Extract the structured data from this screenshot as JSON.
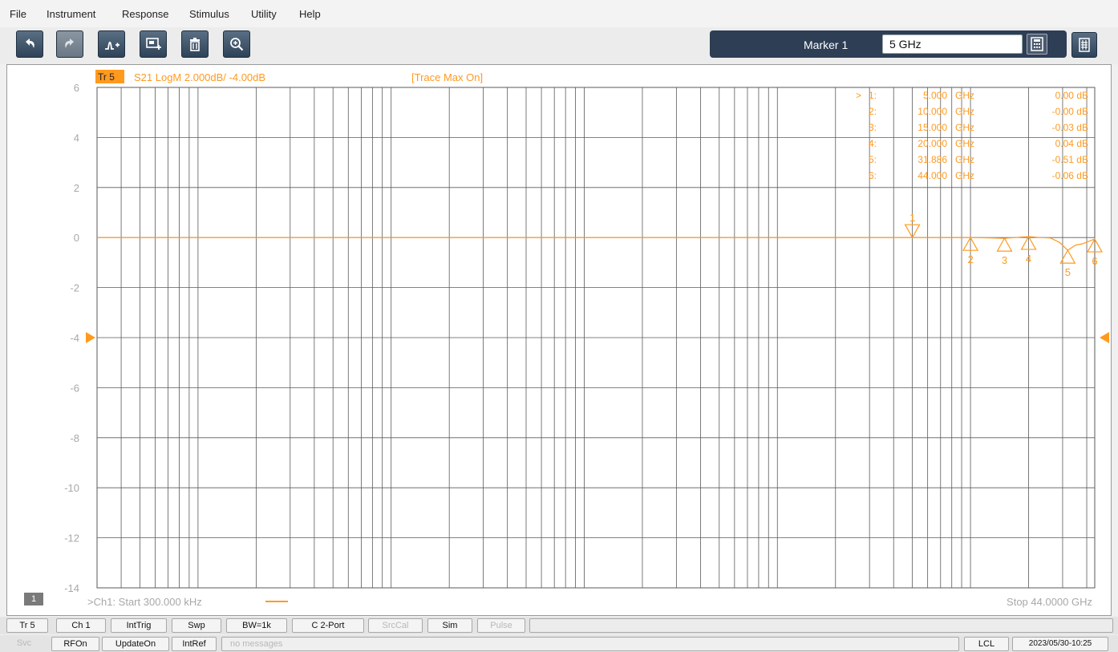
{
  "menu": [
    "File",
    "Instrument",
    "Response",
    "Stimulus",
    "Utility",
    "Help"
  ],
  "toolbar": {
    "icons": [
      "undo-icon",
      "redo-icon",
      "add-trace-icon",
      "add-window-icon",
      "delete-icon",
      "zoom-icon"
    ],
    "marker_label": "Marker 1",
    "marker_value": "5 GHz"
  },
  "trace": {
    "badge": "Tr 5",
    "title": "S21 LogM 2.000dB/ -4.00dB",
    "status": "[Trace Max On]",
    "color": "#ff9a1f"
  },
  "markers": [
    {
      "id": "1",
      "prefix": ">",
      "freq": "5.000",
      "unit": "GHz",
      "value": "0.00 dB"
    },
    {
      "id": "2",
      "prefix": "",
      "freq": "10.000",
      "unit": "GHz",
      "value": "-0.00 dB"
    },
    {
      "id": "3",
      "prefix": "",
      "freq": "15.000",
      "unit": "GHz",
      "value": "-0.03 dB"
    },
    {
      "id": "4",
      "prefix": "",
      "freq": "20.000",
      "unit": "GHz",
      "value": "0.04 dB"
    },
    {
      "id": "5",
      "prefix": "",
      "freq": "31.886",
      "unit": "GHz",
      "value": "-0.51 dB"
    },
    {
      "id": "6",
      "prefix": "",
      "freq": "44.000",
      "unit": "GHz",
      "value": "-0.06 dB"
    }
  ],
  "chart_data": {
    "type": "line",
    "title": "S21 LogM 2.000dB/ -4.00dB",
    "ylim": [
      -14,
      6
    ],
    "yticks": [
      6,
      4,
      2,
      0,
      -2,
      -4,
      -6,
      -8,
      -10,
      -12,
      -14
    ],
    "reference_level": -4,
    "x_start": "300.000 kHz",
    "x_stop": "44.0000 GHz",
    "log_x": true,
    "grid": true,
    "series": [
      {
        "name": "Tr 5",
        "x_ghz": [
          0.0003,
          10,
          12,
          15,
          17,
          20,
          23,
          26,
          29,
          31.886,
          35,
          38,
          41,
          44
        ],
        "y": [
          0.0,
          -0.0,
          -0.01,
          -0.03,
          0.0,
          0.04,
          0.0,
          -0.02,
          -0.2,
          -0.51,
          -0.3,
          -0.25,
          -0.15,
          -0.06
        ]
      }
    ],
    "marker_points": [
      {
        "label": "1",
        "x_ghz": 5.0,
        "y": 0.0
      },
      {
        "label": "2",
        "x_ghz": 10.0,
        "y": -0.0
      },
      {
        "label": "3",
        "x_ghz": 15.0,
        "y": -0.03
      },
      {
        "label": "4",
        "x_ghz": 20.0,
        "y": 0.04
      },
      {
        "label": "5",
        "x_ghz": 31.886,
        "y": -0.51
      },
      {
        "label": "6",
        "x_ghz": 44.0,
        "y": -0.06
      }
    ],
    "channel": "1",
    "start_label": ">Ch1:  Start  300.000 kHz",
    "stop_label": "Stop  44.0000 GHz"
  },
  "status_row1": [
    "Tr 5",
    "Ch 1",
    "IntTrig",
    "Swp",
    "BW=1k",
    "C  2-Port",
    "SrcCal",
    "Sim",
    "Pulse"
  ],
  "status_row2": [
    "Svc",
    "RFOn",
    "UpdateOn",
    "IntRef",
    "no messages",
    "LCL",
    "2023/05/30-10:25"
  ]
}
